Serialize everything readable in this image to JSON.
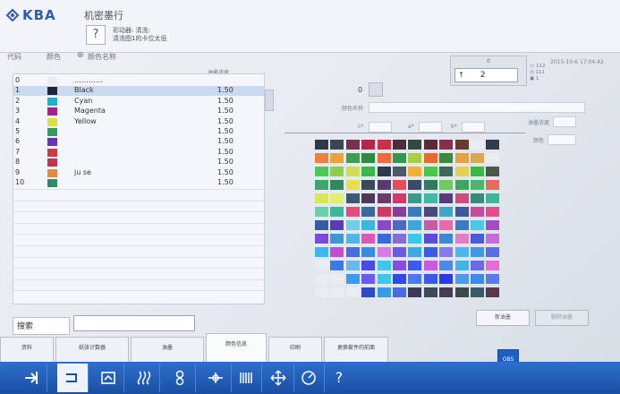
{
  "header": {
    "logo_text": "KBA",
    "title": "机密墨行",
    "help_label": "?",
    "message_line1": "彩动器: 清洗:",
    "message_line2": "清洗图1的卡位太低"
  },
  "counter": {
    "top_value": "0",
    "field_value": "2",
    "arrow": "↑",
    "info_line1": "▭ 112",
    "info_line2": "◷ 111",
    "info_line3": "▣ 1"
  },
  "datetime": "2015-10-6  17:04:42",
  "list_headers": {
    "code": "代码",
    "color": "颜色",
    "name": "颜色名称",
    "density": "油墨浓度"
  },
  "rows": [
    {
      "code": "0",
      "color": "#e9ecf0",
      "name": "…………",
      "density": "",
      "selected": false
    },
    {
      "code": "1",
      "color": "#1c2a36",
      "name": "Black",
      "density": "1.50",
      "selected": true
    },
    {
      "code": "2",
      "color": "#1fb0d8",
      "name": "Cyan",
      "density": "1.50",
      "selected": false
    },
    {
      "code": "3",
      "color": "#b01a8e",
      "name": "Magenta",
      "density": "1.50",
      "selected": false
    },
    {
      "code": "4",
      "color": "#d8e03a",
      "name": "Yellow",
      "density": "1.50",
      "selected": false
    },
    {
      "code": "5",
      "color": "#2aa35a",
      "name": "",
      "density": "1.50",
      "selected": false
    },
    {
      "code": "6",
      "color": "#6b2fc4",
      "name": "",
      "density": "1.50",
      "selected": false
    },
    {
      "code": "7",
      "color": "#d63546",
      "name": "",
      "density": "1.50",
      "selected": false
    },
    {
      "code": "8",
      "color": "#c8324a",
      "name": "",
      "density": "1.50",
      "selected": false
    },
    {
      "code": "9",
      "color": "#e8893c",
      "name": "ju se",
      "density": "1.50",
      "selected": false
    },
    {
      "code": "10",
      "color": "#2e8a6a",
      "name": "",
      "density": "1.50",
      "selected": false
    }
  ],
  "detail": {
    "code_value": "0",
    "name_label": "颜色名称",
    "l_label": "L*",
    "a_label": "a*",
    "b_label": "b*",
    "density_label": "油墨浓度",
    "color_label": "颜色"
  },
  "palette": [
    [
      "#2d3a4a",
      "#3a4658",
      "#7a2f4a",
      "#b0294a",
      "#c8314a",
      "#4a2f3a",
      "#334a3a",
      "#5a2a3a",
      "#8a2e4a",
      "#6a3a2a",
      "#3a5a4a",
      "#2e3e4e"
    ],
    [
      "#e8833a",
      "#f0a03a",
      "#3aa04a",
      "#2e8a3e",
      "#f06a3a",
      "#2e9a4a",
      "#a8d03a",
      "#e86a2e",
      "#3a8a3a",
      "#e8a03a",
      "#d8a84a",
      "#e85a3a"
    ],
    [
      "#4ac85a",
      "#8ad04a",
      "#d0e04a",
      "#3ab84a",
      "#2e3a4a",
      "#4a5a6a",
      "#f0b03a",
      "#4ac84a",
      "#3a6a5a",
      "#e8d04a",
      "#3ab84a",
      "#4a5a4a"
    ],
    [
      "#3aa86a",
      "#2e8a5a",
      "#e8e04a",
      "#3a4a5a",
      "#5a3a6a",
      "#e84a5a",
      "#3a4a6a",
      "#2e7a5a",
      "#6ad05a",
      "#3aa85a",
      "#4ab86a",
      "#e86a5a"
    ],
    [
      "#d8e85a",
      "#e0f06a",
      "#3a5a7a",
      "#4a3a5a",
      "#6a3a6a",
      "#d03a6a",
      "#3a9a8a",
      "#3ab8a8",
      "#5a3a7a",
      "#d04a7a",
      "#3a8a7a",
      "#3ab89a"
    ],
    [
      "#6ad0a8",
      "#3ab898",
      "#e84a7a",
      "#3a6a9a",
      "#d03a5a",
      "#8a3a9a",
      "#3a7aba",
      "#4a4a7a",
      "#3aa8c8",
      "#3a5a9a",
      "#c84a9a",
      "#e84a8a"
    ],
    [
      "#3a5aa8",
      "#5a3ab8",
      "#6ad0e8",
      "#3ab8d8",
      "#8a4ac8",
      "#4a6ac8",
      "#3aa8d8",
      "#c85aa8",
      "#e86aa8",
      "#3a7ac8",
      "#4ac8e8",
      "#a84ac8"
    ],
    [
      "#7a4ad8",
      "#3a9ad8",
      "#4ab8e8",
      "#d85ab8",
      "#3a6ad8",
      "#8a6ad8",
      "#3ac8e8",
      "#5a4ad8",
      "#3a8ad8",
      "#e87ac8",
      "#4a5ad8",
      "#c86ad8"
    ],
    [
      "#3ab8f0",
      "#c84ad8",
      "#4a6ae8",
      "#3a8ae8",
      "#d87ae8",
      "#6a5ae8",
      "#3aa8e8",
      "#3a5ae8",
      "#8a7ae8",
      "#4ab8f0",
      "#3a9ae8",
      "#5a6ae8"
    ],
    [
      "#d84ad8",
      "#3a7ae8",
      "#6ab8f0",
      "#4a4ae8",
      "#3ac8f0",
      "#8a4ae8",
      "#3a5af0",
      "#c85ae8",
      "#4a8ae8",
      "#3ab8e8",
      "#6a6ae8",
      "#e86ad8"
    ],
    [
      "#3a6af0",
      "#4ab8f0",
      "#3a9af0",
      "#6a5af0",
      "#3ac8f0",
      "#2e4ae8",
      "#4a7af0",
      "#3a5ae8",
      "#2e3ae8",
      "#4a9af0",
      "#3a8af0",
      "#5a7af0"
    ],
    [
      "#3a7ae8",
      "#4ab8e8",
      "#3a5ad8",
      "#2e4ac8",
      "#3a9ae8",
      "#4a6ae8",
      "#3a3a5a",
      "#3a4a5a",
      "#4a3a5a",
      "#3a4a4a",
      "#3a5a6a",
      "#5a3a4a"
    ]
  ],
  "palette_blanks": [
    [
      11,
      0
    ],
    [
      11,
      1
    ],
    [
      11,
      2
    ],
    [
      10,
      0
    ],
    [
      10,
      1
    ],
    [
      9,
      0
    ],
    [
      0,
      10
    ],
    [
      1,
      11
    ]
  ],
  "search": {
    "label": "搜索",
    "value": ""
  },
  "right_buttons": {
    "b1": "新油墨",
    "b2": "删除油墨"
  },
  "tabs": [
    "资料",
    "纸张计数器",
    "油墨",
    "颜色信息",
    "印刷",
    "更换套件的前面"
  ],
  "active_tab": 3,
  "ok_button": "OBS"
}
